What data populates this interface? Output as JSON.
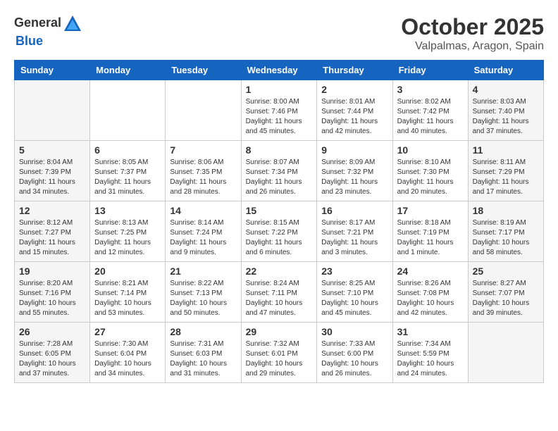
{
  "header": {
    "logo_general": "General",
    "logo_blue": "Blue",
    "month": "October 2025",
    "location": "Valpalmas, Aragon, Spain"
  },
  "days_of_week": [
    "Sunday",
    "Monday",
    "Tuesday",
    "Wednesday",
    "Thursday",
    "Friday",
    "Saturday"
  ],
  "weeks": [
    [
      {
        "day": "",
        "info": ""
      },
      {
        "day": "",
        "info": ""
      },
      {
        "day": "",
        "info": ""
      },
      {
        "day": "1",
        "info": "Sunrise: 8:00 AM\nSunset: 7:46 PM\nDaylight: 11 hours\nand 45 minutes."
      },
      {
        "day": "2",
        "info": "Sunrise: 8:01 AM\nSunset: 7:44 PM\nDaylight: 11 hours\nand 42 minutes."
      },
      {
        "day": "3",
        "info": "Sunrise: 8:02 AM\nSunset: 7:42 PM\nDaylight: 11 hours\nand 40 minutes."
      },
      {
        "day": "4",
        "info": "Sunrise: 8:03 AM\nSunset: 7:40 PM\nDaylight: 11 hours\nand 37 minutes."
      }
    ],
    [
      {
        "day": "5",
        "info": "Sunrise: 8:04 AM\nSunset: 7:39 PM\nDaylight: 11 hours\nand 34 minutes."
      },
      {
        "day": "6",
        "info": "Sunrise: 8:05 AM\nSunset: 7:37 PM\nDaylight: 11 hours\nand 31 minutes."
      },
      {
        "day": "7",
        "info": "Sunrise: 8:06 AM\nSunset: 7:35 PM\nDaylight: 11 hours\nand 28 minutes."
      },
      {
        "day": "8",
        "info": "Sunrise: 8:07 AM\nSunset: 7:34 PM\nDaylight: 11 hours\nand 26 minutes."
      },
      {
        "day": "9",
        "info": "Sunrise: 8:09 AM\nSunset: 7:32 PM\nDaylight: 11 hours\nand 23 minutes."
      },
      {
        "day": "10",
        "info": "Sunrise: 8:10 AM\nSunset: 7:30 PM\nDaylight: 11 hours\nand 20 minutes."
      },
      {
        "day": "11",
        "info": "Sunrise: 8:11 AM\nSunset: 7:29 PM\nDaylight: 11 hours\nand 17 minutes."
      }
    ],
    [
      {
        "day": "12",
        "info": "Sunrise: 8:12 AM\nSunset: 7:27 PM\nDaylight: 11 hours\nand 15 minutes."
      },
      {
        "day": "13",
        "info": "Sunrise: 8:13 AM\nSunset: 7:25 PM\nDaylight: 11 hours\nand 12 minutes."
      },
      {
        "day": "14",
        "info": "Sunrise: 8:14 AM\nSunset: 7:24 PM\nDaylight: 11 hours\nand 9 minutes."
      },
      {
        "day": "15",
        "info": "Sunrise: 8:15 AM\nSunset: 7:22 PM\nDaylight: 11 hours\nand 6 minutes."
      },
      {
        "day": "16",
        "info": "Sunrise: 8:17 AM\nSunset: 7:21 PM\nDaylight: 11 hours\nand 3 minutes."
      },
      {
        "day": "17",
        "info": "Sunrise: 8:18 AM\nSunset: 7:19 PM\nDaylight: 11 hours\nand 1 minute."
      },
      {
        "day": "18",
        "info": "Sunrise: 8:19 AM\nSunset: 7:17 PM\nDaylight: 10 hours\nand 58 minutes."
      }
    ],
    [
      {
        "day": "19",
        "info": "Sunrise: 8:20 AM\nSunset: 7:16 PM\nDaylight: 10 hours\nand 55 minutes."
      },
      {
        "day": "20",
        "info": "Sunrise: 8:21 AM\nSunset: 7:14 PM\nDaylight: 10 hours\nand 53 minutes."
      },
      {
        "day": "21",
        "info": "Sunrise: 8:22 AM\nSunset: 7:13 PM\nDaylight: 10 hours\nand 50 minutes."
      },
      {
        "day": "22",
        "info": "Sunrise: 8:24 AM\nSunset: 7:11 PM\nDaylight: 10 hours\nand 47 minutes."
      },
      {
        "day": "23",
        "info": "Sunrise: 8:25 AM\nSunset: 7:10 PM\nDaylight: 10 hours\nand 45 minutes."
      },
      {
        "day": "24",
        "info": "Sunrise: 8:26 AM\nSunset: 7:08 PM\nDaylight: 10 hours\nand 42 minutes."
      },
      {
        "day": "25",
        "info": "Sunrise: 8:27 AM\nSunset: 7:07 PM\nDaylight: 10 hours\nand 39 minutes."
      }
    ],
    [
      {
        "day": "26",
        "info": "Sunrise: 7:28 AM\nSunset: 6:05 PM\nDaylight: 10 hours\nand 37 minutes."
      },
      {
        "day": "27",
        "info": "Sunrise: 7:30 AM\nSunset: 6:04 PM\nDaylight: 10 hours\nand 34 minutes."
      },
      {
        "day": "28",
        "info": "Sunrise: 7:31 AM\nSunset: 6:03 PM\nDaylight: 10 hours\nand 31 minutes."
      },
      {
        "day": "29",
        "info": "Sunrise: 7:32 AM\nSunset: 6:01 PM\nDaylight: 10 hours\nand 29 minutes."
      },
      {
        "day": "30",
        "info": "Sunrise: 7:33 AM\nSunset: 6:00 PM\nDaylight: 10 hours\nand 26 minutes."
      },
      {
        "day": "31",
        "info": "Sunrise: 7:34 AM\nSunset: 5:59 PM\nDaylight: 10 hours\nand 24 minutes."
      },
      {
        "day": "",
        "info": ""
      }
    ]
  ]
}
